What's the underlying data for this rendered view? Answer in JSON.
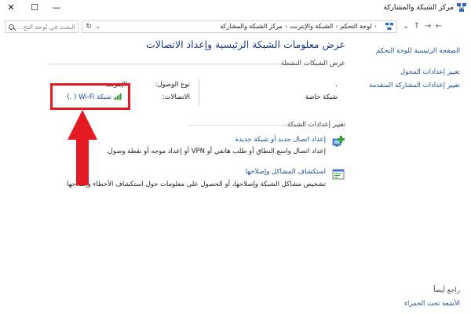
{
  "window": {
    "title": "مركز الشبكة والمشاركة",
    "controls": {
      "close": "✕",
      "maximize": "☐",
      "minimize": "—"
    }
  },
  "address_bar": {
    "search_placeholder": "البحث في لوحة التح...",
    "breadcrumbs": [
      "لوحة التحكم",
      "الشبكة والإنترنت",
      "مركز الشبكة والمشاركة"
    ],
    "separator": "›",
    "dropdown_glyph": "⌄",
    "refresh_glyph": "↻"
  },
  "sidebar": {
    "links": [
      "الصفحة الرئيسية للوحة التحكم",
      "تغيير إعدادات المحول",
      "تغيير إعدادات المشاركة المتقدمة"
    ],
    "see_also": {
      "heading": "راجع أيضاً",
      "links": [
        "الأشعة تحت الحمراء"
      ]
    }
  },
  "main": {
    "title": "عرض معلومات الشبكة الرئيسية وإعداد الاتصالات",
    "active_networks": {
      "heading": "عرض الشبكات النشطة",
      "network_name": ".",
      "network_type": "شبكة خاصة",
      "access_type_label": "نوع الوصول:",
      "access_type_value": "الإنترنت",
      "connections_label": "الاتصالات:",
      "connection_link": "شبكة Wi-Fi (  .)"
    },
    "change_settings": {
      "heading": "تغيير إعدادات الشبكة",
      "tasks": [
        {
          "title": "إعداد اتصال جديد أو شبكة جديدة",
          "description": "إعداد اتصال واسع النطاق أو طلب هاتفي أو VPN أو إعداد موجه أو نقطة وصول."
        },
        {
          "title": "استكشاف المشاكل وإصلاحها",
          "description": "تشخيص مشاكل الشبكة وإصلاحها، أو الحصول على معلومات حول استكشاف الأخطاء وإصلاحها"
        }
      ]
    }
  },
  "colors": {
    "highlight": "#e51b24",
    "link": "#1a4f93",
    "title": "#1e3d8f"
  }
}
